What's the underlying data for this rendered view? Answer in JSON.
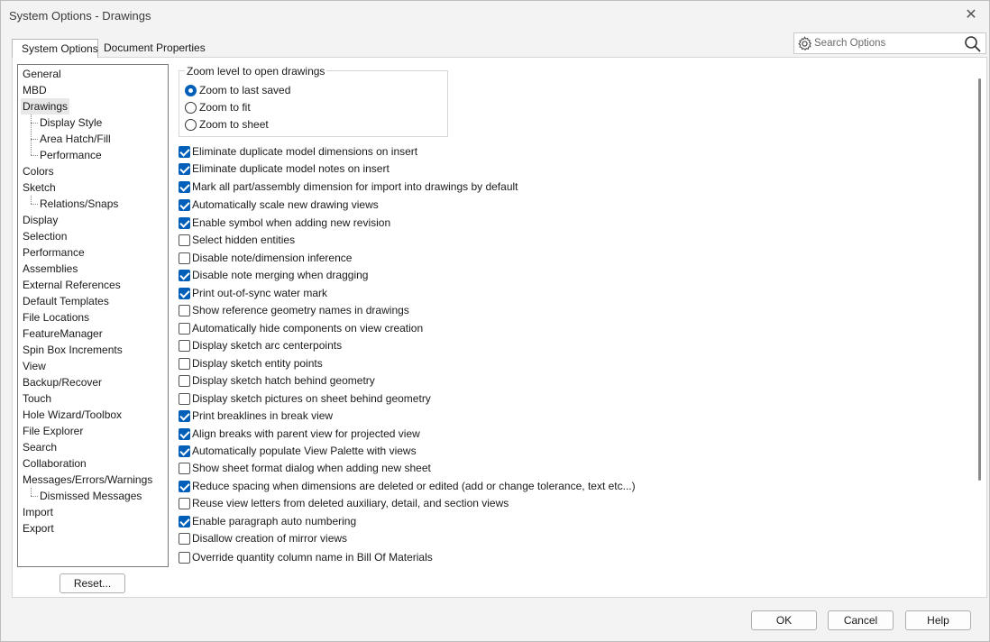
{
  "window": {
    "title": "System Options - Drawings"
  },
  "tabs": [
    {
      "label": "System Options",
      "active": true
    },
    {
      "label": "Document Properties",
      "active": false
    }
  ],
  "search": {
    "placeholder": "Search Options"
  },
  "tree": {
    "items": [
      {
        "label": "General",
        "level": 0
      },
      {
        "label": "MBD",
        "level": 0
      },
      {
        "label": "Drawings",
        "level": 0,
        "selected": true
      },
      {
        "label": "Display Style",
        "level": 1
      },
      {
        "label": "Area Hatch/Fill",
        "level": 1
      },
      {
        "label": "Performance",
        "level": 1
      },
      {
        "label": "Colors",
        "level": 0
      },
      {
        "label": "Sketch",
        "level": 0
      },
      {
        "label": "Relations/Snaps",
        "level": 1
      },
      {
        "label": "Display",
        "level": 0
      },
      {
        "label": "Selection",
        "level": 0
      },
      {
        "label": "Performance",
        "level": 0
      },
      {
        "label": "Assemblies",
        "level": 0
      },
      {
        "label": "External References",
        "level": 0
      },
      {
        "label": "Default Templates",
        "level": 0
      },
      {
        "label": "File Locations",
        "level": 0
      },
      {
        "label": "FeatureManager",
        "level": 0
      },
      {
        "label": "Spin Box Increments",
        "level": 0
      },
      {
        "label": "View",
        "level": 0
      },
      {
        "label": "Backup/Recover",
        "level": 0
      },
      {
        "label": "Touch",
        "level": 0
      },
      {
        "label": "Hole Wizard/Toolbox",
        "level": 0
      },
      {
        "label": "File Explorer",
        "level": 0
      },
      {
        "label": "Search",
        "level": 0
      },
      {
        "label": "Collaboration",
        "level": 0
      },
      {
        "label": "Messages/Errors/Warnings",
        "level": 0
      },
      {
        "label": "Dismissed Messages",
        "level": 1
      },
      {
        "label": "Import",
        "level": 0
      },
      {
        "label": "Export",
        "level": 0
      }
    ]
  },
  "reset_label": "Reset...",
  "zoom_group": {
    "title": "Zoom level to open drawings",
    "options": [
      {
        "label": "Zoom to last saved",
        "selected": true
      },
      {
        "label": "Zoom to fit",
        "selected": false
      },
      {
        "label": "Zoom to sheet",
        "selected": false
      }
    ]
  },
  "options": [
    {
      "label": "Eliminate duplicate model dimensions on insert",
      "checked": true
    },
    {
      "label": "Eliminate duplicate model notes on insert",
      "checked": true
    },
    {
      "label": "Mark all part/assembly dimension for import into drawings by default",
      "checked": true
    },
    {
      "label": "Automatically scale new drawing views",
      "checked": true
    },
    {
      "label": "Enable symbol when adding new revision",
      "checked": true
    },
    {
      "label": "Select hidden entities",
      "checked": false
    },
    {
      "label": "Disable note/dimension inference",
      "checked": false
    },
    {
      "label": "Disable note merging when dragging",
      "checked": true
    },
    {
      "label": "Print out-of-sync water mark",
      "checked": true
    },
    {
      "label": "Show reference geometry names in drawings",
      "checked": false
    },
    {
      "label": "Automatically hide components on view creation",
      "checked": false
    },
    {
      "label": "Display sketch arc centerpoints",
      "checked": false
    },
    {
      "label": "Display sketch entity points",
      "checked": false
    },
    {
      "label": "Display sketch hatch behind geometry",
      "checked": false
    },
    {
      "label": "Display sketch pictures on sheet behind geometry",
      "checked": false
    },
    {
      "label": "Print breaklines in break view",
      "checked": true
    },
    {
      "label": "Align breaks with parent view for projected view",
      "checked": true
    },
    {
      "label": "Automatically populate View Palette with views",
      "checked": true
    },
    {
      "label": "Show sheet format dialog when adding new sheet",
      "checked": false
    },
    {
      "label": "Reduce spacing when dimensions are deleted or edited (add or change tolerance, text etc...)",
      "checked": true
    },
    {
      "label": "Reuse view letters from deleted auxiliary, detail, and section views",
      "checked": false
    },
    {
      "label": "Enable paragraph auto numbering",
      "checked": true
    },
    {
      "label": "Disallow creation of mirror views",
      "checked": false
    },
    {
      "label": "Override quantity column name in Bill Of Materials",
      "checked": false
    }
  ],
  "buttons": {
    "ok": "OK",
    "cancel": "Cancel",
    "help": "Help"
  },
  "colors": {
    "accent": "#005fb8"
  }
}
